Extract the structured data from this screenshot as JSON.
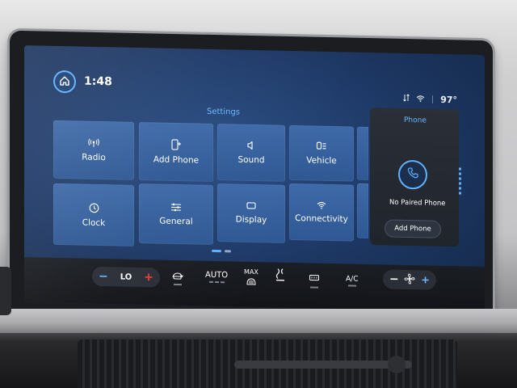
{
  "status_bar": {
    "time": "1:48",
    "temperature": "97°",
    "home_icon": "home-icon",
    "signal_icon": "data-transfer-icon",
    "wifi_icon": "wifi-icon"
  },
  "settings": {
    "title": "Settings",
    "tiles": [
      {
        "label": "Radio",
        "icon": "radio-antenna-icon"
      },
      {
        "label": "Add Phone",
        "icon": "add-phone-icon"
      },
      {
        "label": "Sound",
        "icon": "speaker-icon"
      },
      {
        "label": "Vehicle",
        "icon": "vehicle-icon"
      },
      {
        "label": "Clock",
        "icon": "clock-icon"
      },
      {
        "label": "General",
        "icon": "sliders-icon"
      },
      {
        "label": "Display",
        "icon": "display-icon"
      },
      {
        "label": "Connectivity",
        "icon": "wifi-icon"
      }
    ]
  },
  "phone_panel": {
    "title": "Phone",
    "status": "No Paired Phone",
    "button_label": "Add Phone",
    "icon": "phone-icon"
  },
  "climate": {
    "temp_minus": "−",
    "temp_value": "LO",
    "temp_plus": "+",
    "auto_label": "AUTO",
    "max_label": "MAX",
    "ac_label": "A/C",
    "fan_minus": "−",
    "fan_plus": "+",
    "recirc_icon": "recirculation-icon",
    "max_defrost_icon": "max-defrost-icon",
    "seat_icon": "seat-heat-icon",
    "rear_defrost_icon": "rear-defrost-icon",
    "fan_icon": "fan-icon"
  },
  "colors": {
    "accent": "#5fb0ff",
    "tile": "#3e6aa8",
    "temp_plus": "#ff3b3b"
  }
}
